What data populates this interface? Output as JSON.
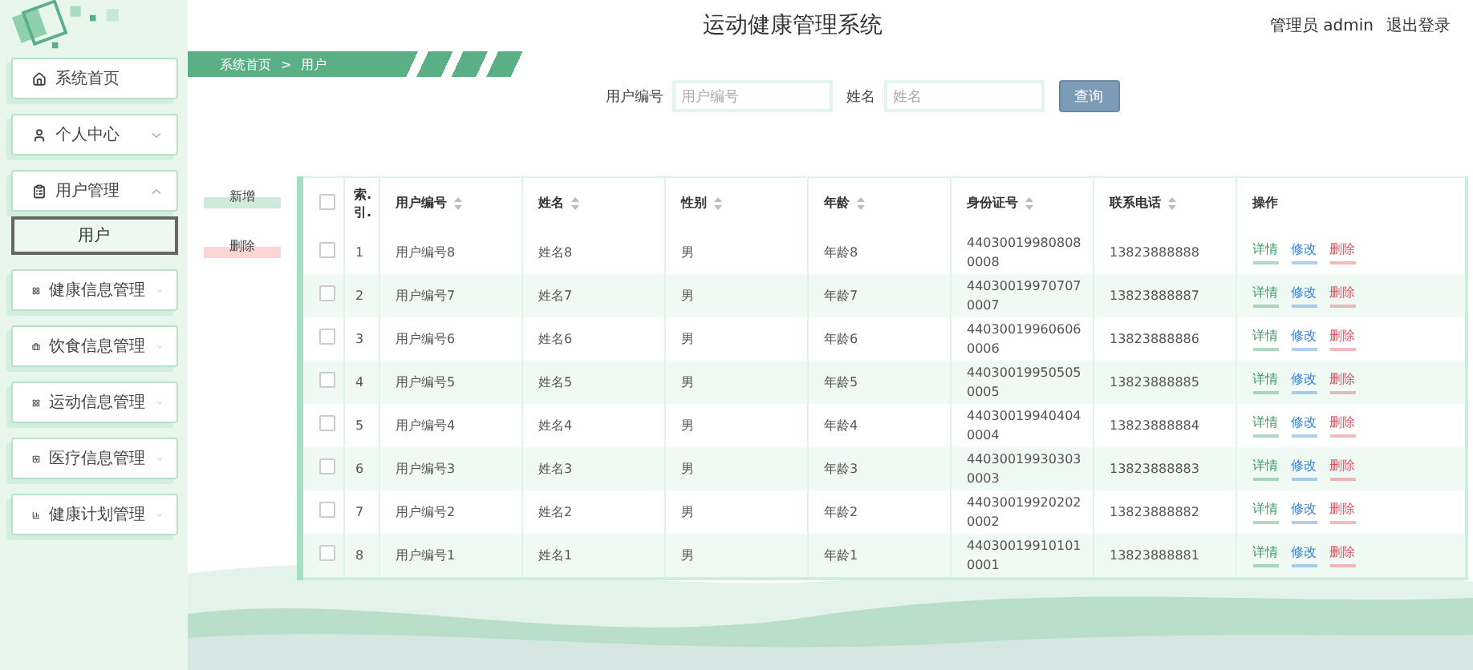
{
  "header": {
    "title": "运动健康管理系统",
    "user": "管理员 admin",
    "logout": "退出登录"
  },
  "sidebar": {
    "items": [
      {
        "label": "系统首页",
        "kind": "link"
      },
      {
        "label": "个人中心",
        "kind": "menu",
        "expanded": false
      },
      {
        "label": "用户管理",
        "kind": "menu",
        "expanded": true,
        "children": [
          {
            "label": "用户",
            "selected": true
          }
        ]
      },
      {
        "label": "健康信息管理",
        "kind": "menu",
        "expanded": false
      },
      {
        "label": "饮食信息管理",
        "kind": "menu",
        "expanded": false
      },
      {
        "label": "运动信息管理",
        "kind": "menu",
        "expanded": false
      },
      {
        "label": "医疗信息管理",
        "kind": "menu",
        "expanded": false
      },
      {
        "label": "健康计划管理",
        "kind": "menu",
        "expanded": false
      }
    ]
  },
  "breadcrumb": {
    "items": [
      "系统首页",
      "用户"
    ],
    "separator": ">"
  },
  "search": {
    "fields": [
      {
        "label": "用户编号",
        "placeholder": "用户编号"
      },
      {
        "label": "姓名",
        "placeholder": "姓名"
      }
    ],
    "button": "查询"
  },
  "actions": [
    {
      "label": "新增",
      "kind": "add"
    },
    {
      "label": "删除",
      "kind": "delete"
    }
  ],
  "table": {
    "select_all": {
      "checked": false
    },
    "columns": [
      {
        "label": "索.引.",
        "sortable": false
      },
      {
        "label": "用户编号",
        "sortable": true
      },
      {
        "label": "姓名",
        "sortable": true
      },
      {
        "label": "性别",
        "sortable": true
      },
      {
        "label": "年龄",
        "sortable": true
      },
      {
        "label": "身份证号",
        "sortable": true
      },
      {
        "label": "联系电话",
        "sortable": true
      },
      {
        "label": "操作",
        "sortable": false
      }
    ],
    "rows": [
      {
        "checked": false,
        "cells": [
          "1",
          "用户编号8",
          "姓名8",
          "男",
          "年龄8",
          "440300199808080008",
          "13823888888"
        ],
        "actions": [
          "详情",
          "修改",
          "删除"
        ]
      },
      {
        "checked": false,
        "cells": [
          "2",
          "用户编号7",
          "姓名7",
          "男",
          "年龄7",
          "440300199707070007",
          "13823888887"
        ],
        "actions": [
          "详情",
          "修改",
          "删除"
        ]
      },
      {
        "checked": false,
        "cells": [
          "3",
          "用户编号6",
          "姓名6",
          "男",
          "年龄6",
          "440300199606060006",
          "13823888886"
        ],
        "actions": [
          "详情",
          "修改",
          "删除"
        ]
      },
      {
        "checked": false,
        "cells": [
          "4",
          "用户编号5",
          "姓名5",
          "男",
          "年龄5",
          "440300199505050005",
          "13823888885"
        ],
        "actions": [
          "详情",
          "修改",
          "删除"
        ]
      },
      {
        "checked": false,
        "cells": [
          "5",
          "用户编号4",
          "姓名4",
          "男",
          "年龄4",
          "440300199404040004",
          "13823888884"
        ],
        "actions": [
          "详情",
          "修改",
          "删除"
        ]
      },
      {
        "checked": false,
        "cells": [
          "6",
          "用户编号3",
          "姓名3",
          "男",
          "年龄3",
          "440300199303030003",
          "13823888883"
        ],
        "actions": [
          "详情",
          "修改",
          "删除"
        ]
      },
      {
        "checked": false,
        "cells": [
          "7",
          "用户编号2",
          "姓名2",
          "男",
          "年龄2",
          "440300199202020002",
          "13823888882"
        ],
        "actions": [
          "详情",
          "修改",
          "删除"
        ]
      },
      {
        "checked": false,
        "cells": [
          "8",
          "用户编号1",
          "姓名1",
          "男",
          "年龄1",
          "440300199101010001",
          "13823888881"
        ],
        "actions": [
          "详情",
          "修改",
          "删除"
        ]
      }
    ]
  }
}
